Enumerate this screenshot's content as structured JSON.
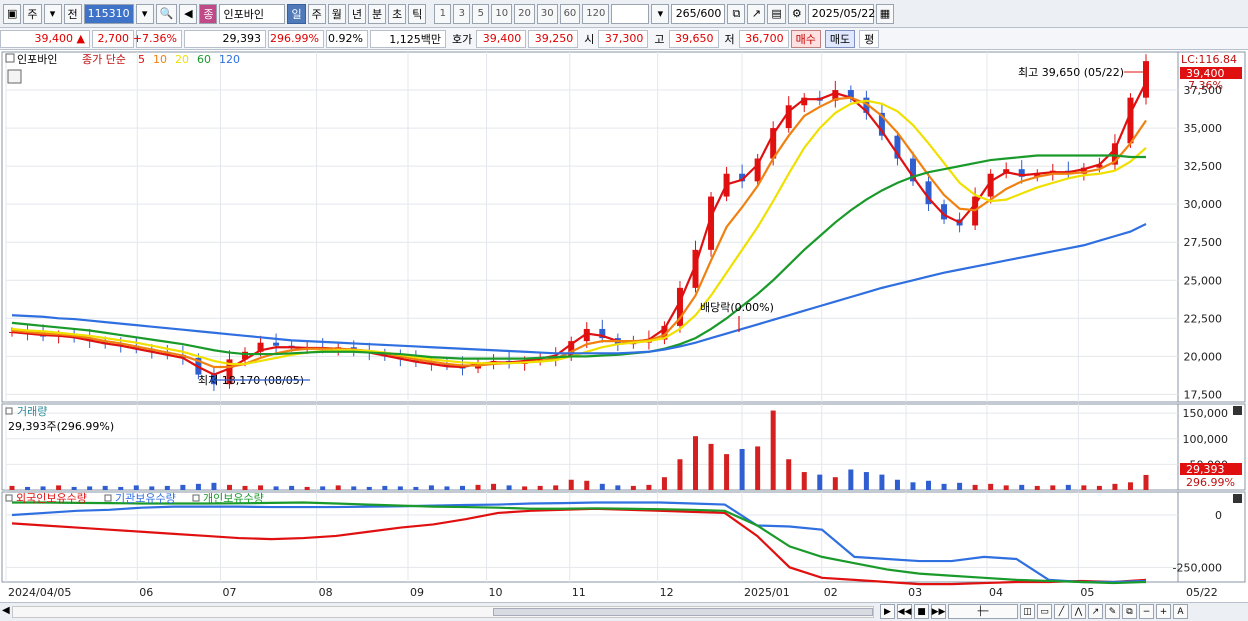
{
  "toolbar": {
    "period_type": "주",
    "prev_label": "전",
    "code": "115310",
    "stock_name": "인포바인",
    "stock_badge": "종",
    "period_buttons": [
      "일",
      "주",
      "월",
      "년",
      "분",
      "초",
      "틱"
    ],
    "active_period": "일",
    "minute_buttons": [
      "1",
      "3",
      "5",
      "10",
      "20",
      "30",
      "60",
      "120"
    ],
    "count": "265/600",
    "date": "2025/05/22"
  },
  "quote": {
    "price": "39,400 ▲",
    "change": "2,700",
    "change_pct": "+7.36%",
    "volume": "29,393",
    "volume_pct": "296.99%",
    "turnover": "0.92%",
    "amount": "1,125백만",
    "bid_label": "호가",
    "bid1": "39,400",
    "bid2": "39,250",
    "open_label": "시",
    "open": "37,300",
    "high_label": "고",
    "high": "39,650",
    "low_label": "저",
    "low": "36,700",
    "buy_label": "매수",
    "sell_label": "매도",
    "eval_label": "평"
  },
  "legend": {
    "name": "인포바인",
    "series_label": "종가 단순",
    "ma": [
      {
        "label": "5",
        "color": "#e01010"
      },
      {
        "label": "10",
        "color": "#f08010"
      },
      {
        "label": "20",
        "color": "#f0e000"
      },
      {
        "label": "60",
        "color": "#1a9a2a"
      },
      {
        "label": "120",
        "color": "#2f6fe0"
      }
    ]
  },
  "annotations": {
    "high": "최고 39,650 (05/22)",
    "low": "최저 18,170 (08/05)",
    "dividend": "배당락(0.00%)",
    "lc": "LC:116.84",
    "last_price": "39,400",
    "last_pct": "7.36%"
  },
  "volume_panel": {
    "title": "거래량",
    "current": "29,393주(296.99%)",
    "last_value": "29,393",
    "last_pct": "296.99%",
    "ticks": [
      "150,000",
      "100,000",
      "50,000"
    ]
  },
  "holdings_panel": {
    "series_labels": [
      "외국인보유수량",
      "기관보유수량",
      "개인보유수량"
    ],
    "colors": [
      "#e01010",
      "#2f6fe0",
      "#1a9a2a"
    ],
    "ticks": [
      "0",
      "-250,000"
    ]
  },
  "x_axis": {
    "labels": [
      "2024/04/05",
      "06",
      "07",
      "08",
      "09",
      "10",
      "11",
      "12",
      "2025/01",
      "02",
      "03",
      "04",
      "05"
    ],
    "right_label": "05/22"
  },
  "chart_data": [
    {
      "type": "candlestick",
      "title": "인포바인",
      "ylim": [
        17000,
        40000
      ],
      "yticks": [
        17500,
        20000,
        22500,
        25000,
        27500,
        30000,
        32500,
        35000,
        37500
      ],
      "x_labels": [
        "2024/04/05",
        "06",
        "07",
        "08",
        "09",
        "10",
        "11",
        "12",
        "2025/01",
        "02",
        "03",
        "04",
        "05"
      ],
      "close_series": [
        21600,
        21500,
        21300,
        21400,
        21200,
        21000,
        20800,
        20700,
        20500,
        20300,
        20100,
        19900,
        18800,
        18170,
        19800,
        20300,
        20900,
        20700,
        20600,
        20600,
        20500,
        20600,
        20300,
        20200,
        20000,
        19800,
        19600,
        19500,
        19400,
        19200,
        19600,
        19700,
        19500,
        19700,
        19800,
        20000,
        21000,
        21800,
        21200,
        20800,
        20900,
        21100,
        22000,
        24500,
        27000,
        30500,
        32000,
        31500,
        33000,
        35000,
        36500,
        37000,
        36800,
        37500,
        37000,
        36000,
        34500,
        33000,
        31500,
        30000,
        29000,
        28600,
        30500,
        32000,
        32300,
        31800,
        32000,
        32200,
        32000,
        32400,
        32600,
        34000,
        37000,
        39400
      ],
      "high": 39650,
      "low": 18170,
      "last": 39400
    },
    {
      "type": "line",
      "name": "5",
      "values": [
        21600,
        21500,
        21400,
        21350,
        21250,
        21050,
        20850,
        20700,
        20500,
        20300,
        20100,
        19900,
        19300,
        18800,
        19200,
        19800,
        20400,
        20600,
        20600,
        20550,
        20550,
        20500,
        20400,
        20250,
        20050,
        19850,
        19650,
        19500,
        19350,
        19300,
        19500,
        19600,
        19600,
        19700,
        19850,
        20050,
        20800,
        21500,
        21350,
        21000,
        20950,
        21100,
        21800,
        23600,
        26000,
        29200,
        31300,
        31600,
        32600,
        34600,
        36100,
        36900,
        36900,
        37300,
        37000,
        36100,
        34800,
        33300,
        31800,
        30400,
        29300,
        28800,
        30000,
        31500,
        32100,
        31900,
        32000,
        32100,
        32100,
        32300,
        32600,
        33600,
        36000,
        38000
      ]
    },
    {
      "type": "line",
      "name": "10",
      "values": [
        21700,
        21600,
        21500,
        21450,
        21350,
        21200,
        21000,
        20850,
        20650,
        20450,
        20250,
        20050,
        19700,
        19300,
        19300,
        19500,
        19900,
        20200,
        20400,
        20500,
        20500,
        20500,
        20450,
        20350,
        20200,
        20000,
        19800,
        19650,
        19500,
        19400,
        19400,
        19500,
        19550,
        19600,
        19700,
        19850,
        20300,
        20800,
        21000,
        21000,
        21000,
        21050,
        21400,
        22500,
        24000,
        26300,
        28500,
        29800,
        31200,
        33000,
        34500,
        35800,
        36400,
        36900,
        37000,
        36600,
        35800,
        34700,
        33300,
        31900,
        30600,
        29700,
        29600,
        30300,
        31000,
        31500,
        31800,
        32000,
        32000,
        32100,
        32300,
        32800,
        34000,
        35500
      ]
    },
    {
      "type": "line",
      "name": "20",
      "values": [
        21800,
        21700,
        21650,
        21550,
        21450,
        21350,
        21200,
        21050,
        20900,
        20700,
        20500,
        20300,
        20000,
        19700,
        19500,
        19500,
        19700,
        19900,
        20100,
        20250,
        20350,
        20400,
        20400,
        20350,
        20250,
        20100,
        19950,
        19800,
        19700,
        19600,
        19550,
        19550,
        19550,
        19600,
        19650,
        19750,
        20000,
        20300,
        20600,
        20800,
        20900,
        21000,
        21200,
        21800,
        22700,
        24000,
        25500,
        27000,
        28500,
        30200,
        32000,
        33700,
        35000,
        36000,
        36600,
        36800,
        36600,
        36100,
        35200,
        34000,
        32700,
        31400,
        30600,
        30200,
        30300,
        30700,
        31100,
        31400,
        31700,
        31900,
        32000,
        32200,
        32800,
        33700
      ]
    },
    {
      "type": "line",
      "name": "60",
      "values": [
        22200,
        22100,
        22000,
        21900,
        21800,
        21700,
        21550,
        21400,
        21250,
        21100,
        20950,
        20800,
        20600,
        20400,
        20250,
        20150,
        20150,
        20150,
        20200,
        20250,
        20300,
        20300,
        20300,
        20250,
        20200,
        20150,
        20050,
        19950,
        19900,
        19850,
        19850,
        19850,
        19850,
        19850,
        19900,
        19950,
        20000,
        20000,
        20050,
        20100,
        20200,
        20300,
        20500,
        20800,
        21200,
        21800,
        22500,
        23300,
        24100,
        25000,
        26000,
        27000,
        27900,
        28800,
        29600,
        30300,
        30900,
        31400,
        31800,
        32100,
        32300,
        32500,
        32700,
        32900,
        33000,
        33100,
        33200,
        33200,
        33200,
        33200,
        33200,
        33200,
        33100,
        33100
      ]
    },
    {
      "type": "line",
      "name": "120",
      "values": [
        22700,
        22650,
        22600,
        22500,
        22450,
        22350,
        22250,
        22150,
        22050,
        21950,
        21850,
        21750,
        21650,
        21550,
        21450,
        21350,
        21250,
        21150,
        21050,
        21000,
        20950,
        20900,
        20850,
        20800,
        20750,
        20700,
        20650,
        20600,
        20550,
        20500,
        20450,
        20400,
        20350,
        20300,
        20250,
        20200,
        20200,
        20200,
        20200,
        20200,
        20250,
        20300,
        20450,
        20650,
        20900,
        21200,
        21500,
        21800,
        22100,
        22400,
        22700,
        23000,
        23300,
        23600,
        23900,
        24200,
        24500,
        24750,
        25000,
        25250,
        25500,
        25700,
        25900,
        26100,
        26300,
        26500,
        26700,
        26900,
        27100,
        27300,
        27600,
        27900,
        28200,
        28700
      ]
    },
    {
      "type": "bar",
      "title": "거래량",
      "ylim": [
        0,
        160000
      ],
      "yticks": [
        50000,
        100000,
        150000
      ],
      "values": [
        8000,
        6000,
        7000,
        9000,
        6000,
        7000,
        8000,
        6000,
        9000,
        7000,
        8000,
        10000,
        12000,
        14000,
        10000,
        8000,
        9000,
        7000,
        8000,
        6000,
        7000,
        9000,
        7000,
        6000,
        8000,
        7000,
        6000,
        9000,
        7000,
        8000,
        10000,
        12000,
        9000,
        7000,
        8000,
        9000,
        20000,
        18000,
        12000,
        9000,
        8000,
        10000,
        25000,
        60000,
        105000,
        90000,
        70000,
        80000,
        85000,
        155000,
        60000,
        35000,
        30000,
        25000,
        40000,
        35000,
        30000,
        20000,
        15000,
        18000,
        12000,
        14000,
        10000,
        12000,
        9000,
        10000,
        8000,
        9000,
        10000,
        9000,
        8000,
        12000,
        15000,
        29393
      ]
    },
    {
      "type": "line",
      "title": "외국인보유수량",
      "series": [
        {
          "name": "외국인보유수량",
          "values": [
            -40000,
            -50000,
            -60000,
            -70000,
            -80000,
            -90000,
            -100000,
            -110000,
            -115000,
            -110000,
            -100000,
            -80000,
            -60000,
            -45000,
            -20000,
            10000,
            20000,
            25000,
            30000,
            25000,
            20000,
            15000,
            10000,
            -100000,
            -250000,
            -300000,
            -310000,
            -320000,
            -330000,
            -330000,
            -325000,
            -320000,
            -320000,
            -315000,
            -320000,
            -310000
          ]
        },
        {
          "name": "기관보유수량",
          "values": [
            0,
            10000,
            20000,
            25000,
            35000,
            40000,
            40000,
            40000,
            38000,
            38000,
            38000,
            40000,
            42000,
            45000,
            48000,
            50000,
            55000,
            57000,
            60000,
            60000,
            60000,
            55000,
            50000,
            -50000,
            -55000,
            -70000,
            -200000,
            -210000,
            -220000,
            -220000,
            -200000,
            -210000,
            -310000,
            -320000,
            -320000,
            -315000
          ]
        },
        {
          "name": "개인보유수량",
          "values": [
            60000,
            60000,
            58000,
            57000,
            55000,
            55000,
            55000,
            56000,
            58000,
            60000,
            55000,
            50000,
            45000,
            40000,
            38000,
            35000,
            30000,
            30000,
            32000,
            30000,
            28000,
            25000,
            20000,
            -50000,
            -150000,
            -200000,
            -230000,
            -260000,
            -280000,
            -290000,
            -300000,
            -310000,
            -315000,
            -320000,
            -325000,
            -320000
          ]
        }
      ],
      "ylim": [
        -320000,
        110000
      ],
      "yticks": [
        0,
        -250000
      ]
    }
  ]
}
